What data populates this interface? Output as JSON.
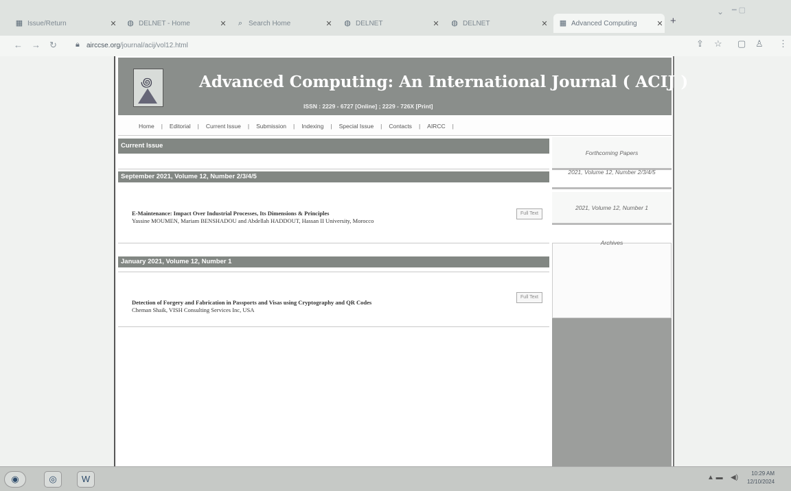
{
  "browser": {
    "tabs": [
      {
        "title": "Issue/Return",
        "icon": "document-icon",
        "left": 0
      },
      {
        "title": "DELNET - Home",
        "icon": "globe-icon",
        "left": 0
      },
      {
        "title": "Search Home",
        "icon": "search-icon",
        "left": 0
      },
      {
        "title": "DELNET",
        "icon": "globe-icon",
        "left": 0
      },
      {
        "title": "DELNET",
        "icon": "globe-icon",
        "left": 0
      },
      {
        "title": "Advanced Computing",
        "icon": "document-icon",
        "left": 0
      }
    ],
    "new_tab_glyph": "+",
    "url_host": "airccse.org",
    "url_path": "/journal/acij/vol12.html"
  },
  "journal": {
    "title": "Advanced Computing: An International Journal ( ACIJ )",
    "issn": "ISSN : 2229 - 6727 [Online] ; 2229 - 726X [Print]"
  },
  "menu": [
    "Home",
    "Editorial",
    "Current Issue",
    "Submission",
    "Indexing",
    "Special Issue",
    "Contacts",
    "AIRCC"
  ],
  "main": {
    "current_issue_label": "Current Issue",
    "issues": [
      {
        "header": "September 2021, Volume 12, Number 2/3/4/5",
        "papers": [
          {
            "title": "E-Maintenance: Impact Over Industrial Processes, Its Dimensions & Principles",
            "authors": "Yassine MOUMEN, Mariam BENSHADOU and Abdellah HADDOUT, Hassan II University, Morocco",
            "fulltext": "Full Text"
          }
        ]
      },
      {
        "header": "January 2021, Volume 12, Number 1",
        "papers": [
          {
            "title": "Detection of Forgery and Fabrication in Passports and Visas using Cryptography and QR Codes",
            "authors": "Cheman Shaik, VISH Consulting Services Inc, USA",
            "fulltext": "Full Text"
          }
        ]
      }
    ]
  },
  "sidebar": {
    "items": [
      "Forthcoming Papers",
      "2021, Volume 12, Number 2/3/4/5",
      "2021, Volume 12, Number 1",
      "Archives"
    ]
  },
  "taskbar": {
    "time": "10:29 AM",
    "date": "12/10/2024"
  }
}
